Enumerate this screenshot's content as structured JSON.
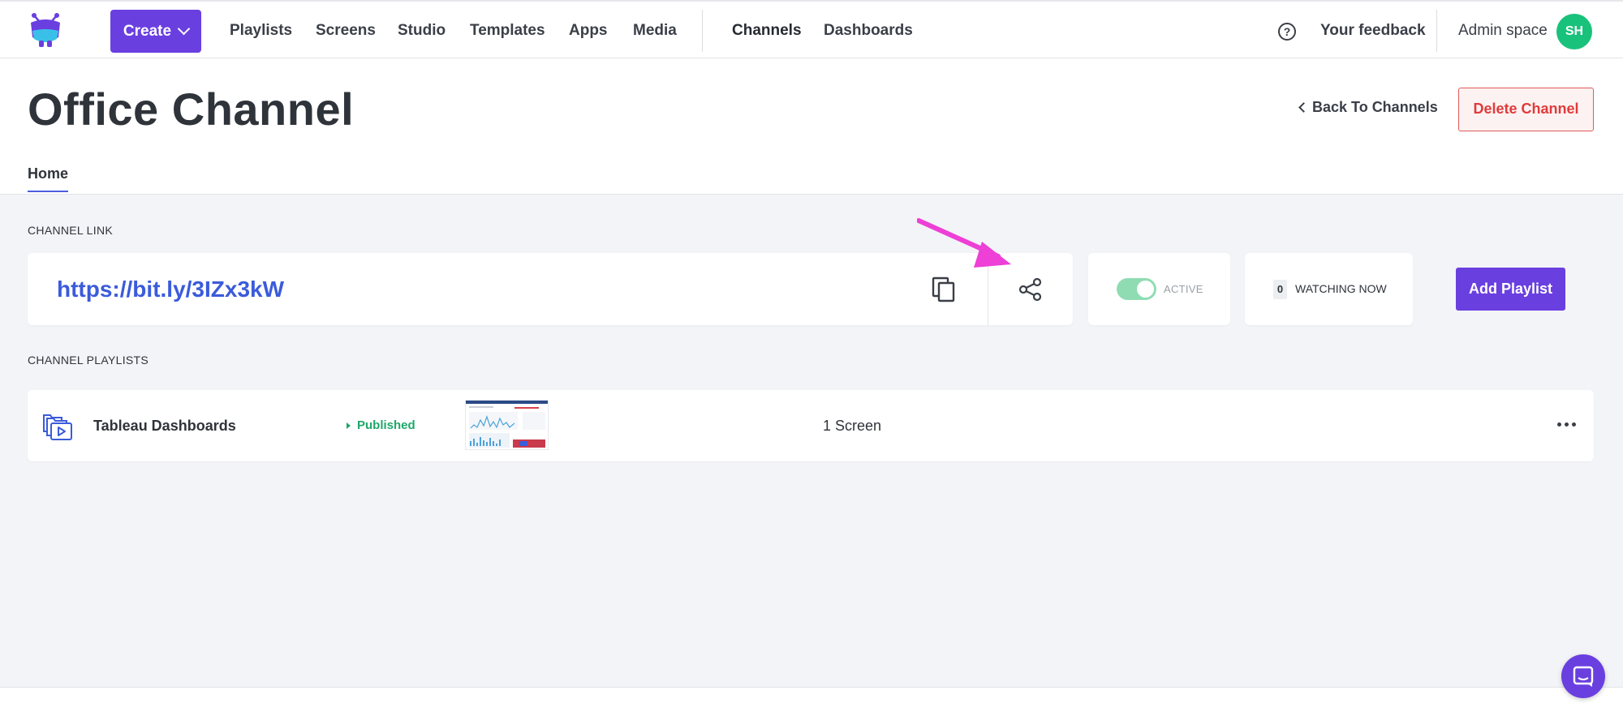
{
  "nav": {
    "create_label": "Create",
    "links": [
      "Playlists",
      "Screens",
      "Studio",
      "Templates",
      "Apps",
      "Media"
    ],
    "links_right": [
      "Channels",
      "Dashboards"
    ],
    "active": "Channels",
    "feedback_label": "Your feedback",
    "account_label": "Admin space",
    "avatar_initials": "SH"
  },
  "header": {
    "title": "Office Channel",
    "back_label": "Back To Channels",
    "delete_label": "Delete Channel",
    "tab_home": "Home"
  },
  "channel_link": {
    "section_label": "CHANNEL LINK",
    "url": "https://bit.ly/3IZx3kW",
    "status_label": "ACTIVE",
    "status_active": true,
    "watching_count": "0",
    "watching_label": "WATCHING NOW",
    "add_playlist_label": "Add Playlist"
  },
  "playlists": {
    "section_label": "CHANNEL PLAYLISTS",
    "items": [
      {
        "name": "Tableau Dashboards",
        "status": "Published",
        "screens": "1 Screen"
      }
    ]
  },
  "colors": {
    "primary": "#6a3fe0",
    "link": "#3b5bdb",
    "danger": "#e03b3b",
    "success": "#1ea76b",
    "annotation": "#ee3fd6"
  }
}
